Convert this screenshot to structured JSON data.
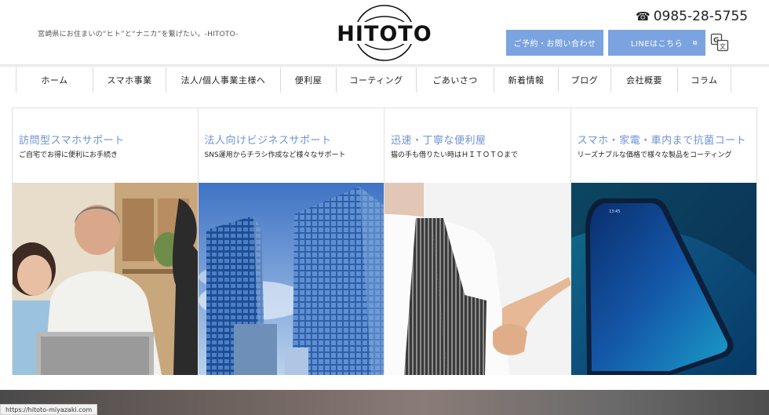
{
  "header": {
    "tagline": "宮崎県にお住まいの“ヒト”と“ナニカ”を繋げたい。-HITOTO-",
    "logo_text": "HITOTO",
    "phone": "0985-28-5755",
    "reserve_button": "ご予約・お問い合わせ",
    "line_button": "LINEはこちら"
  },
  "nav": {
    "items": [
      "ホーム",
      "スマホ事業",
      "法人/個人事業主様へ",
      "便利屋",
      "コーティング",
      "ごあいさつ",
      "新着情報",
      "ブログ",
      "会社概要",
      "コラム"
    ]
  },
  "cards": [
    {
      "title": "訪問型スマホサポート",
      "subtitle": "ご自宅でお得に便利にお手続き",
      "image": "seniors-with-laptop-photo"
    },
    {
      "title": "法人向けビジネスサポート",
      "subtitle": "SNS運用からチラシ作成など様々なサポート",
      "image": "office-buildings-photo"
    },
    {
      "title": "迅速・丁寧な便利屋",
      "subtitle": "猫の手も借りたい時はＨＩＴＯＴＯまで",
      "image": "person-in-apron-photo"
    },
    {
      "title": "スマホ・家電・車内まで抗菌コート",
      "subtitle": "リーズナブルな価格で様々な製品をコーティング",
      "image": "smartphone-photo"
    }
  ],
  "status_bar": {
    "url": "https://hitoto-miyazaki.com"
  }
}
